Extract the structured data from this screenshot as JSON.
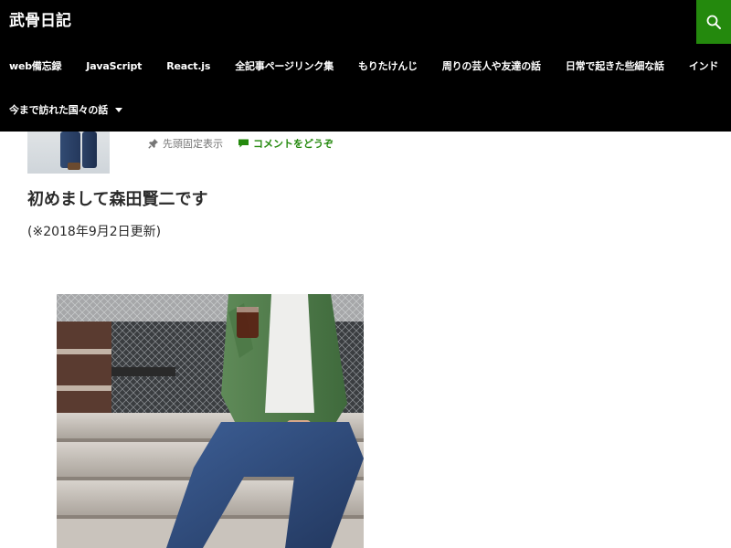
{
  "site": {
    "title": "武骨日記"
  },
  "nav": {
    "row1": [
      {
        "label": "web備忘録"
      },
      {
        "label": "JavaScript"
      },
      {
        "label": "React.js"
      },
      {
        "label": "全記事ページリンク集"
      },
      {
        "label": "もりたけんじ"
      },
      {
        "label": "周りの芸人や友達の話"
      },
      {
        "label": "日常で起きた些細な話"
      },
      {
        "label": "インド"
      }
    ],
    "row2": [
      {
        "label": "今まで訪れた国々の話"
      }
    ]
  },
  "icons": {
    "search": "search-icon",
    "pin": "pin-icon",
    "comment": "comment-icon",
    "caret": "caret-down-icon"
  },
  "colors": {
    "header_bg": "#000000",
    "accent": "#24890d",
    "text": "#2b2b2b",
    "meta_text": "#767676"
  },
  "post": {
    "sticky_label": "先頭固定表示",
    "comments_label": "コメントをどうぞ",
    "title": "初めまして森田賢二です",
    "update_note": "(※2018年9月2日更新)"
  }
}
